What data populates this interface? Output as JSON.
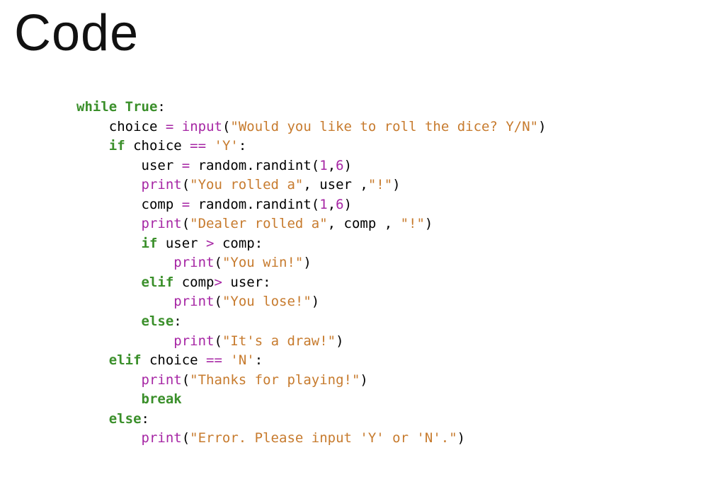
{
  "title": "Code",
  "code": {
    "indent": "    ",
    "lines": [
      {
        "depth": 0,
        "tokens": [
          {
            "t": "while",
            "c": "kw"
          },
          {
            "t": " "
          },
          {
            "t": "True",
            "c": "tru"
          },
          {
            "t": ":",
            "c": "pun"
          }
        ]
      },
      {
        "depth": 1,
        "tokens": [
          {
            "t": "choice "
          },
          {
            "t": "=",
            "c": "op"
          },
          {
            "t": " "
          },
          {
            "t": "input",
            "c": "fn"
          },
          {
            "t": "(",
            "c": "pun"
          },
          {
            "t": "\"Would you like to roll the dice? Y/N\"",
            "c": "str"
          },
          {
            "t": ")",
            "c": "pun"
          }
        ]
      },
      {
        "depth": 1,
        "tokens": [
          {
            "t": "if",
            "c": "kw"
          },
          {
            "t": " choice "
          },
          {
            "t": "==",
            "c": "op"
          },
          {
            "t": " "
          },
          {
            "t": "'Y'",
            "c": "ch"
          },
          {
            "t": ":",
            "c": "pun"
          }
        ]
      },
      {
        "depth": 2,
        "tokens": [
          {
            "t": "user "
          },
          {
            "t": "=",
            "c": "op"
          },
          {
            "t": " random"
          },
          {
            "t": ".",
            "c": "pun"
          },
          {
            "t": "randint"
          },
          {
            "t": "(",
            "c": "pun"
          },
          {
            "t": "1",
            "c": "num"
          },
          {
            "t": ",",
            "c": "pun"
          },
          {
            "t": "6",
            "c": "num"
          },
          {
            "t": ")",
            "c": "pun"
          }
        ]
      },
      {
        "depth": 2,
        "tokens": [
          {
            "t": "print",
            "c": "fn"
          },
          {
            "t": "(",
            "c": "pun"
          },
          {
            "t": "\"You rolled a\"",
            "c": "str"
          },
          {
            "t": ", user ,",
            "c": "pun"
          },
          {
            "t": "\"!\"",
            "c": "str"
          },
          {
            "t": ")",
            "c": "pun"
          }
        ]
      },
      {
        "depth": 2,
        "tokens": [
          {
            "t": "comp "
          },
          {
            "t": "=",
            "c": "op"
          },
          {
            "t": " random"
          },
          {
            "t": ".",
            "c": "pun"
          },
          {
            "t": "randint"
          },
          {
            "t": "(",
            "c": "pun"
          },
          {
            "t": "1",
            "c": "num"
          },
          {
            "t": ",",
            "c": "pun"
          },
          {
            "t": "6",
            "c": "num"
          },
          {
            "t": ")",
            "c": "pun"
          }
        ]
      },
      {
        "depth": 2,
        "tokens": [
          {
            "t": "print",
            "c": "fn"
          },
          {
            "t": "(",
            "c": "pun"
          },
          {
            "t": "\"Dealer rolled a\"",
            "c": "str"
          },
          {
            "t": ", comp , ",
            "c": "pun"
          },
          {
            "t": "\"!\"",
            "c": "str"
          },
          {
            "t": ")",
            "c": "pun"
          }
        ]
      },
      {
        "depth": 2,
        "tokens": [
          {
            "t": "if",
            "c": "kw"
          },
          {
            "t": " user "
          },
          {
            "t": ">",
            "c": "op"
          },
          {
            "t": " comp"
          },
          {
            "t": ":",
            "c": "pun"
          }
        ]
      },
      {
        "depth": 3,
        "tokens": [
          {
            "t": "print",
            "c": "fn"
          },
          {
            "t": "(",
            "c": "pun"
          },
          {
            "t": "\"You win!\"",
            "c": "str"
          },
          {
            "t": ")",
            "c": "pun"
          }
        ]
      },
      {
        "depth": 2,
        "tokens": [
          {
            "t": "elif",
            "c": "kw"
          },
          {
            "t": " comp"
          },
          {
            "t": ">",
            "c": "op"
          },
          {
            "t": " user"
          },
          {
            "t": ":",
            "c": "pun"
          }
        ]
      },
      {
        "depth": 3,
        "tokens": [
          {
            "t": "print",
            "c": "fn"
          },
          {
            "t": "(",
            "c": "pun"
          },
          {
            "t": "\"You lose!\"",
            "c": "str"
          },
          {
            "t": ")",
            "c": "pun"
          }
        ]
      },
      {
        "depth": 2,
        "tokens": [
          {
            "t": "else",
            "c": "kw"
          },
          {
            "t": ":",
            "c": "pun"
          }
        ]
      },
      {
        "depth": 3,
        "tokens": [
          {
            "t": "print",
            "c": "fn"
          },
          {
            "t": "(",
            "c": "pun"
          },
          {
            "t": "\"It's a draw!\"",
            "c": "str"
          },
          {
            "t": ")",
            "c": "pun"
          }
        ]
      },
      {
        "depth": 1,
        "tokens": [
          {
            "t": "elif",
            "c": "kw"
          },
          {
            "t": " choice "
          },
          {
            "t": "==",
            "c": "op"
          },
          {
            "t": " "
          },
          {
            "t": "'N'",
            "c": "ch"
          },
          {
            "t": ":",
            "c": "pun"
          }
        ]
      },
      {
        "depth": 2,
        "tokens": [
          {
            "t": "print",
            "c": "fn"
          },
          {
            "t": "(",
            "c": "pun"
          },
          {
            "t": "\"Thanks for playing!\"",
            "c": "str"
          },
          {
            "t": ")",
            "c": "pun"
          }
        ]
      },
      {
        "depth": 2,
        "tokens": [
          {
            "t": "break",
            "c": "kw"
          }
        ]
      },
      {
        "depth": 1,
        "tokens": [
          {
            "t": "else",
            "c": "kw"
          },
          {
            "t": ":",
            "c": "pun"
          }
        ]
      },
      {
        "depth": 2,
        "tokens": [
          {
            "t": "print",
            "c": "fn"
          },
          {
            "t": "(",
            "c": "pun"
          },
          {
            "t": "\"Error. Please input 'Y' or 'N'.\"",
            "c": "str"
          },
          {
            "t": ")",
            "c": "pun"
          }
        ]
      }
    ]
  }
}
